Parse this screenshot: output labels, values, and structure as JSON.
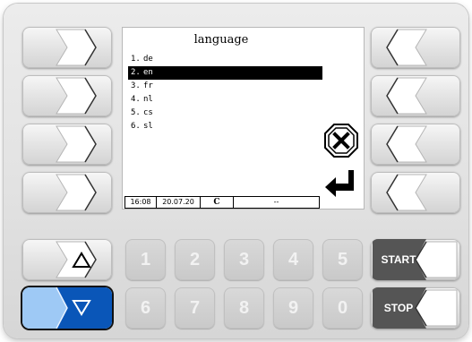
{
  "screen": {
    "title": "language",
    "items": [
      {
        "num": "1.",
        "label": "de",
        "selected": false
      },
      {
        "num": "2.",
        "label": "en",
        "selected": true
      },
      {
        "num": "3.",
        "label": "fr",
        "selected": false
      },
      {
        "num": "4.",
        "label": "nl",
        "selected": false
      },
      {
        "num": "5.",
        "label": "cs",
        "selected": false
      },
      {
        "num": "6.",
        "label": "sl",
        "selected": false
      }
    ]
  },
  "status": {
    "time": "16:08",
    "date": "20.07.20",
    "mode": "C",
    "value": "--"
  },
  "keypad": {
    "row1": [
      "1",
      "2",
      "3",
      "4",
      "5"
    ],
    "row2": [
      "6",
      "7",
      "8",
      "9",
      "0"
    ]
  },
  "buttons": {
    "start_label": "START",
    "stop_label": "STOP"
  },
  "icons": {
    "up": "up-triangle-icon",
    "down": "down-triangle-icon",
    "cancel": "cancel-x-icon",
    "enter": "enter-return-arrow-icon"
  },
  "colors": {
    "active_key_fill": "#0a56b8",
    "active_key_left": "#9ec9f5",
    "selection_bg": "#000000"
  }
}
